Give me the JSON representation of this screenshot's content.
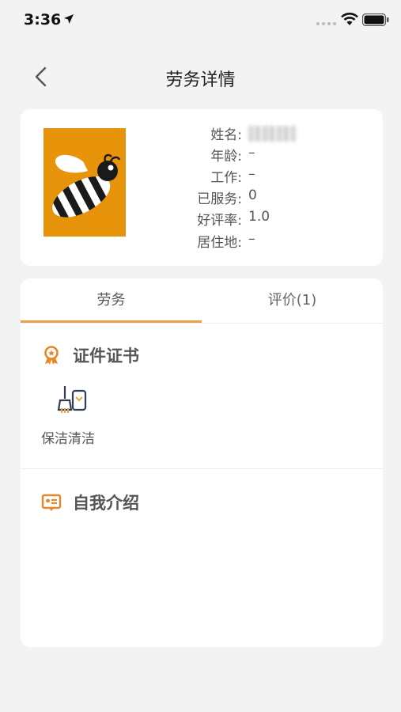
{
  "status_bar": {
    "time": "3:36"
  },
  "nav": {
    "title": "劳务详情"
  },
  "profile": {
    "rows": [
      {
        "label": "姓名:",
        "value": ""
      },
      {
        "label": "年龄:",
        "value": "–"
      },
      {
        "label": "工作:",
        "value": "–"
      },
      {
        "label": "已服务:",
        "value": "0"
      },
      {
        "label": "好评率:",
        "value": "1.0"
      },
      {
        "label": "居住地:",
        "value": "–"
      }
    ]
  },
  "tabs": [
    {
      "label": "劳务",
      "active": true
    },
    {
      "label": "评价(1)",
      "active": false
    }
  ],
  "certificates": {
    "title": "证件证书",
    "items": [
      {
        "label": "保洁清洁",
        "icon": "cleaning-icon"
      }
    ]
  },
  "intro": {
    "title": "自我介绍"
  },
  "colors": {
    "accent": "#e8a24a",
    "avatar_bg": "#e8940b",
    "icon_orange": "#e8872a"
  }
}
